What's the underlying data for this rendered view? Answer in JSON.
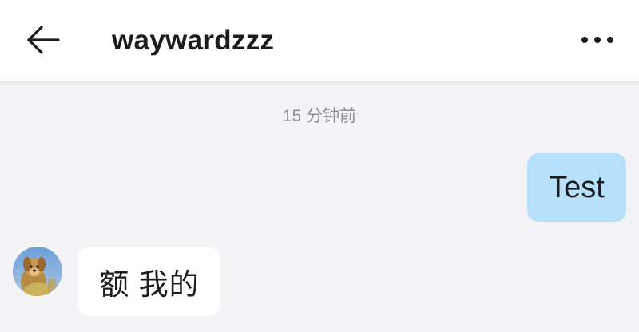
{
  "header": {
    "back_icon": "arrow-left-icon",
    "title": "waywardzzz",
    "more_icon": "more-horizontal-icon"
  },
  "conversation": {
    "timestamp": "15 分钟前",
    "messages": [
      {
        "direction": "outgoing",
        "text": "Test",
        "bubble_color": "#b6e0fb"
      },
      {
        "direction": "incoming",
        "text": "额 我的",
        "bubble_color": "#ffffff",
        "avatar": "dog-avatar"
      }
    ]
  },
  "colors": {
    "background": "#f4f4f6",
    "header": "#ffffff",
    "text": "#1c1c1e",
    "timestamp": "#8e8e93"
  }
}
